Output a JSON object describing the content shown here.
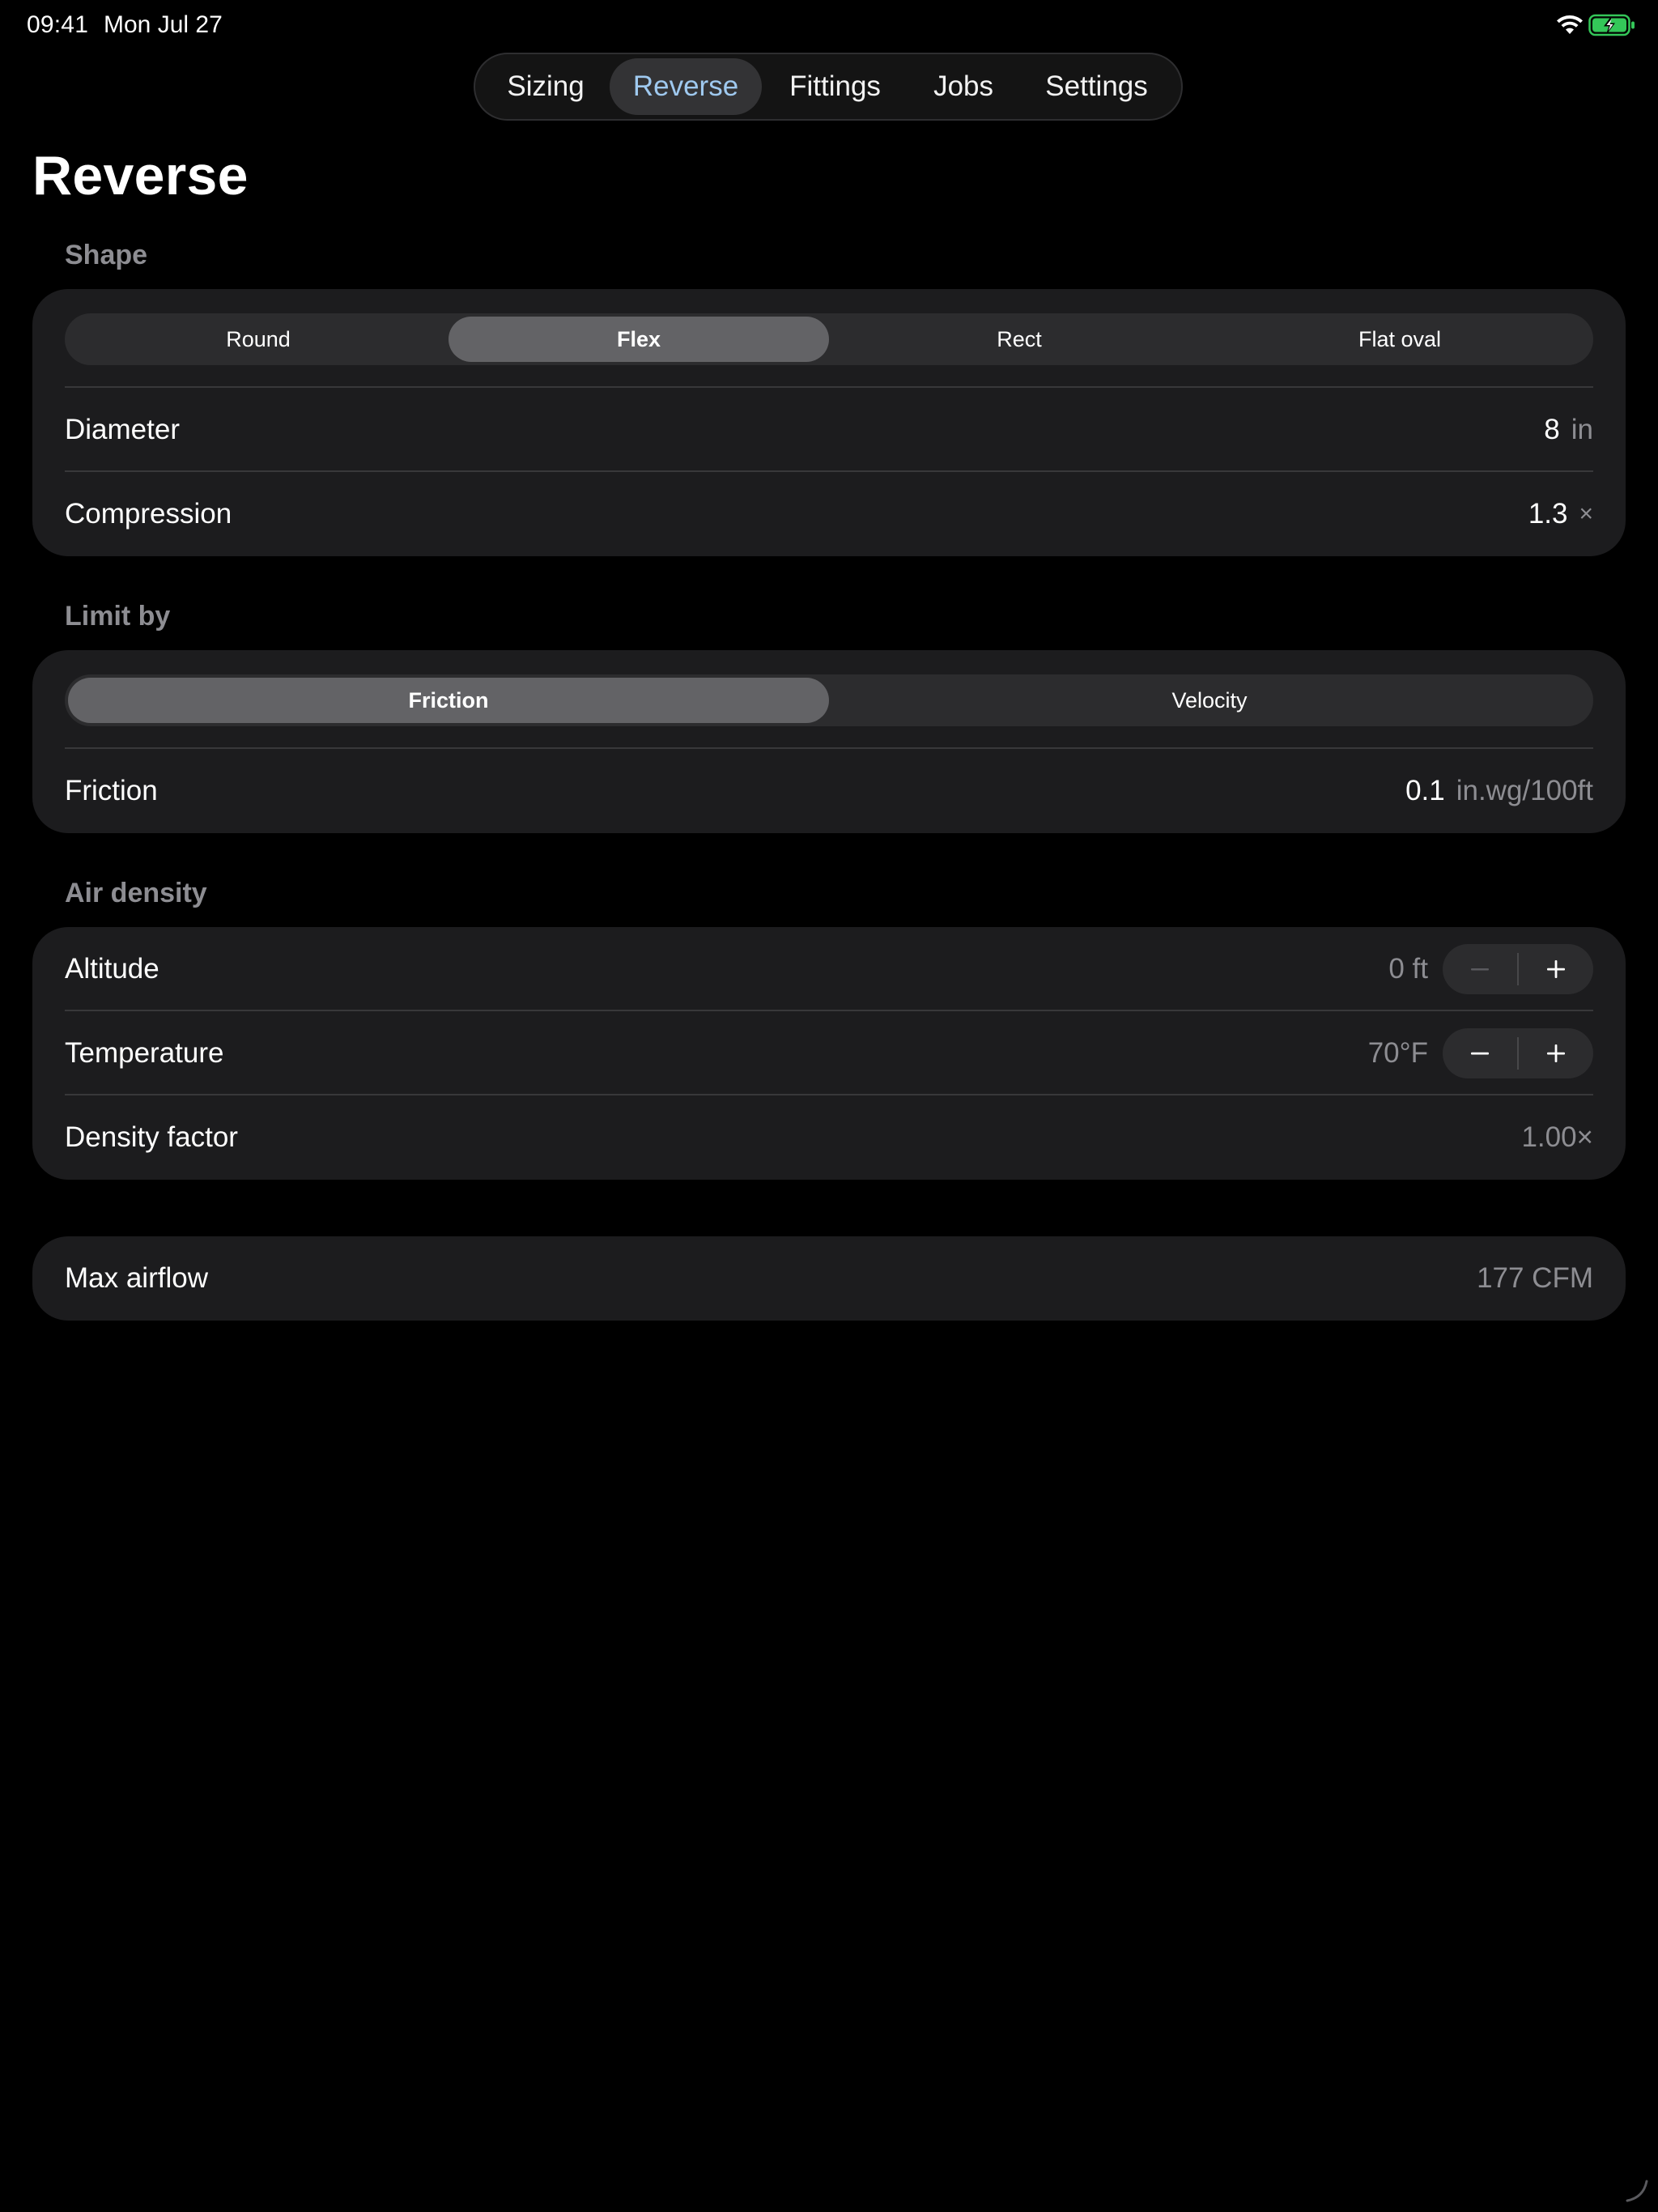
{
  "status_bar": {
    "time": "09:41",
    "date": "Mon Jul 27",
    "wifi_icon": "wifi-icon",
    "battery_icon": "battery-charging-icon"
  },
  "tabs": [
    {
      "label": "Sizing",
      "active": false
    },
    {
      "label": "Reverse",
      "active": true
    },
    {
      "label": "Fittings",
      "active": false
    },
    {
      "label": "Jobs",
      "active": false
    },
    {
      "label": "Settings",
      "active": false
    }
  ],
  "page_title": "Reverse",
  "shape_section": {
    "header": "Shape",
    "options": [
      "Round",
      "Flex",
      "Rect",
      "Flat oval"
    ],
    "selected": "Flex",
    "diameter": {
      "label": "Diameter",
      "value": "8",
      "unit": "in"
    },
    "compression": {
      "label": "Compression",
      "value": "1.3",
      "unit": "×"
    }
  },
  "limit_section": {
    "header": "Limit by",
    "options": [
      "Friction",
      "Velocity"
    ],
    "selected": "Friction",
    "friction": {
      "label": "Friction",
      "value": "0.1",
      "unit": "in.wg/100ft"
    }
  },
  "air_density_section": {
    "header": "Air density",
    "altitude": {
      "label": "Altitude",
      "value": "0 ft"
    },
    "temperature": {
      "label": "Temperature",
      "value": "70°F"
    },
    "density_factor": {
      "label": "Density factor",
      "value": "1.00×"
    }
  },
  "result": {
    "label": "Max airflow",
    "value": "177 CFM"
  },
  "colors": {
    "background": "#000000",
    "card": "#1c1c1e",
    "accent_tab_text": "#9fc9ef",
    "secondary_text": "#8d8d92",
    "battery_green": "#34c759"
  }
}
